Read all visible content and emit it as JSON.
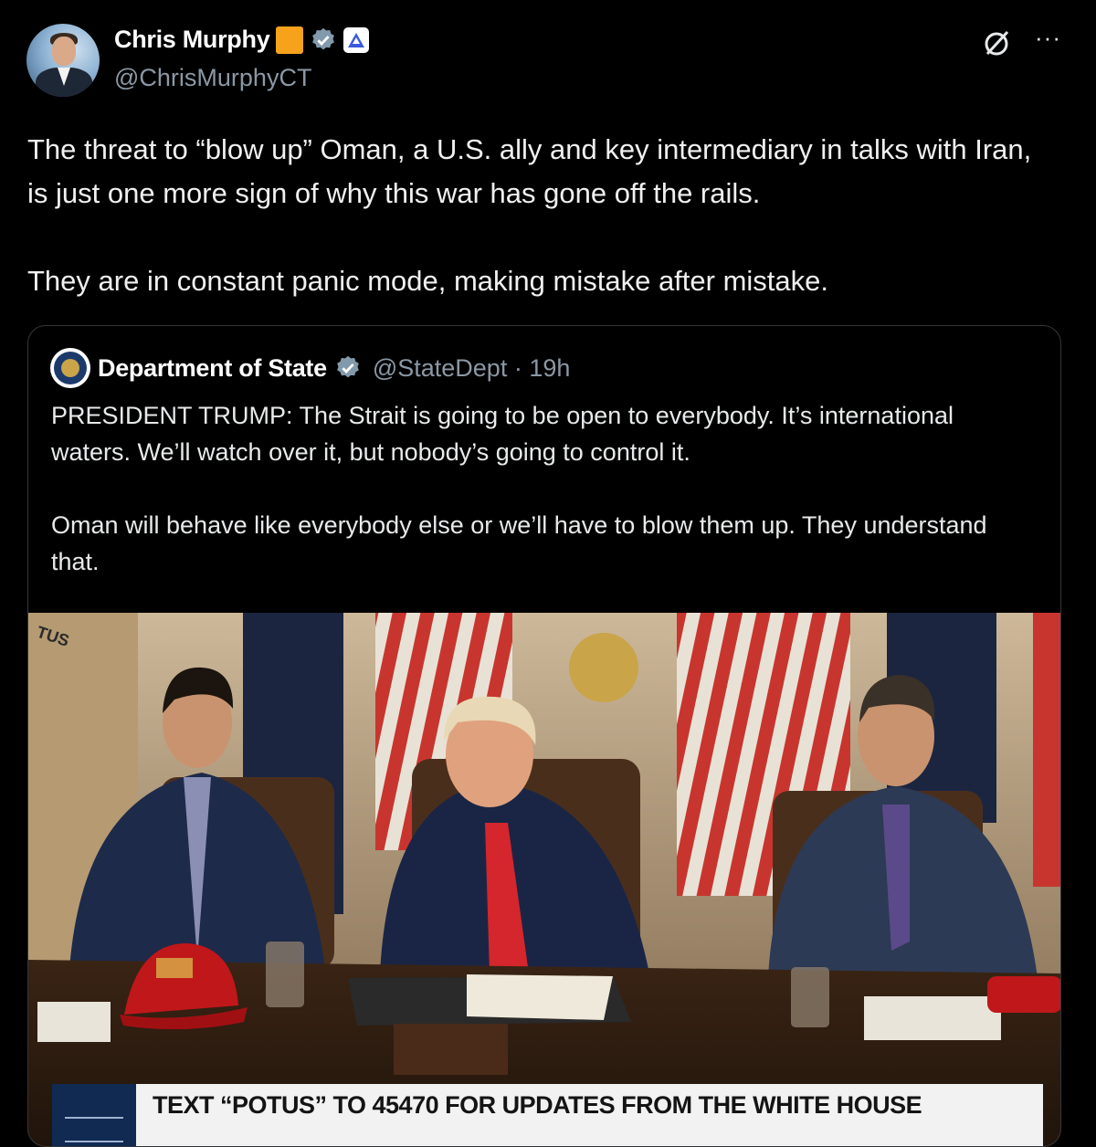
{
  "author": {
    "display_name": "Chris Murphy",
    "handle": "@ChrisMurphyCT",
    "icons": [
      "orange-square-badge",
      "verified-check-icon",
      "triangle-badge-icon"
    ]
  },
  "header_icons": [
    "grok-icon",
    "more-icon"
  ],
  "tweet": {
    "paragraphs": [
      "The threat to “blow up” Oman, a U.S. ally and key intermediary in talks with Iran, is just one more sign of why this war has gone off the rails.",
      "They are in constant panic mode, making mistake after mistake."
    ]
  },
  "quoted_tweet": {
    "display_name": "Department of State",
    "handle_time": "@StateDept · 19h",
    "paragraphs": [
      "PRESIDENT TRUMP: The Strait is going to be open to everybody. It’s international waters. We’ll watch over it, but nobody’s going to control it.",
      "Oman will behave like everybody else or we’ll have to blow them up. They understand that."
    ],
    "media": {
      "banner_text": "TEXT “POTUS” TO 45470 FOR UPDATES FROM THE WHITE HOUSE"
    }
  },
  "colors": {
    "background": "#000000",
    "text": "#e7e9ea",
    "muted": "#8b98a5",
    "verified": "#829aab",
    "badge_orange": "#f7a21b"
  }
}
